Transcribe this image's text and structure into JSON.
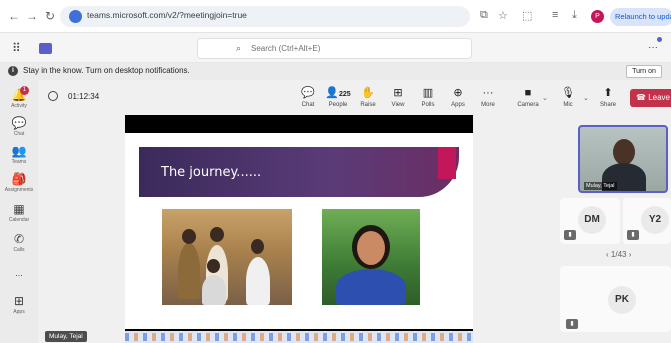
{
  "browser": {
    "url": "teams.microsoft.com/v2/?meetingjoin=true",
    "profile_initial": "P",
    "relaunch_label": "Relaunch to update"
  },
  "teams_bar": {
    "search_placeholder": "Search (Ctrl+Alt+E)"
  },
  "notification": {
    "message": "Stay in the know. Turn on desktop notifications.",
    "turn_on_label": "Turn on"
  },
  "rail": {
    "activity_badge": "1",
    "items": [
      {
        "label": "Activity",
        "icon": "bell-icon"
      },
      {
        "label": "Chat",
        "icon": "chat-icon"
      },
      {
        "label": "Teams",
        "icon": "teams-icon"
      },
      {
        "label": "Assignments",
        "icon": "assignments-icon"
      },
      {
        "label": "Calendar",
        "icon": "calendar-icon"
      },
      {
        "label": "Calls",
        "icon": "phone-icon"
      },
      {
        "label": "...",
        "icon": "more-icon"
      },
      {
        "label": "Apps",
        "icon": "apps-icon"
      }
    ]
  },
  "meeting": {
    "timer": "01:12:34",
    "people_count": "225",
    "toolbar": {
      "chat": "Chat",
      "people": "People",
      "raise": "Raise",
      "view": "View",
      "polls": "Polls",
      "apps": "Apps",
      "more": "More",
      "camera": "Camera",
      "mic": "Mic",
      "share": "Share",
      "leave": "Leave"
    }
  },
  "slide": {
    "title": "The journey......"
  },
  "presenter_name": "Mulay, Tejal",
  "participants": {
    "self_name": "Mulay, Tejal",
    "tiles": [
      {
        "initials": "DM"
      },
      {
        "initials": "Y2"
      },
      {
        "initials": "PK"
      }
    ],
    "pager": "1/43"
  },
  "colors": {
    "accent": "#5b5fc7",
    "leave": "#c4314b",
    "slide_banner": "#4a3268",
    "slide_accent": "#c2185b"
  }
}
